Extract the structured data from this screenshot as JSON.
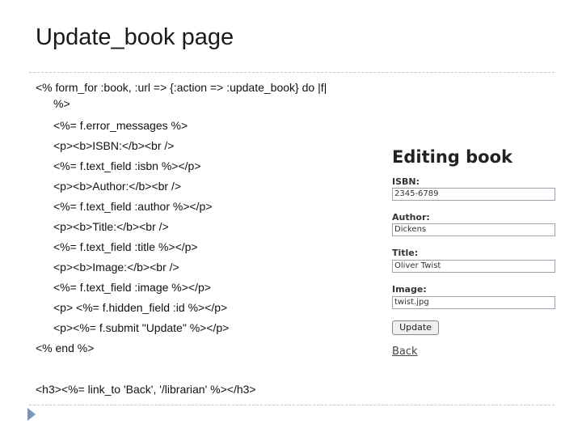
{
  "slide": {
    "title": "Update_book page"
  },
  "code": {
    "line0": "<% form_for :book, :url => {:action => :update_book} do |f|",
    "line1": "%>",
    "line2": "<%= f.error_messages %>",
    "line3": "<p><b>ISBN:</b><br />",
    "line4": "<%= f.text_field :isbn %></p>",
    "line5": "<p><b>Author:</b><br />",
    "line6": "<%= f.text_field :author %></p>",
    "line7": "<p><b>Title:</b><br />",
    "line8": "<%= f.text_field :title %></p>",
    "line9": "<p><b>Image:</b><br />",
    "line10": "<%= f.text_field :image %></p>",
    "line11": "<p> <%= f.hidden_field :id %></p>",
    "line12": "<p><%= f.submit \"Update\" %></p>",
    "line13": "<% end %>",
    "line14": "<h3><%= link_to 'Back', '/librarian' %></h3>"
  },
  "preview": {
    "heading": "Editing book",
    "isbn_label": "ISBN:",
    "isbn_value": "2345-6789",
    "author_label": "Author:",
    "author_value": "Dickens",
    "title_label": "Title:",
    "title_value": "Oliver Twist",
    "image_label": "Image:",
    "image_value": "twist.jpg",
    "update_button": "Update",
    "back_link": "Back"
  },
  "colors": {
    "rule": "#b8c7d9",
    "arrow": "#7d96b8"
  }
}
